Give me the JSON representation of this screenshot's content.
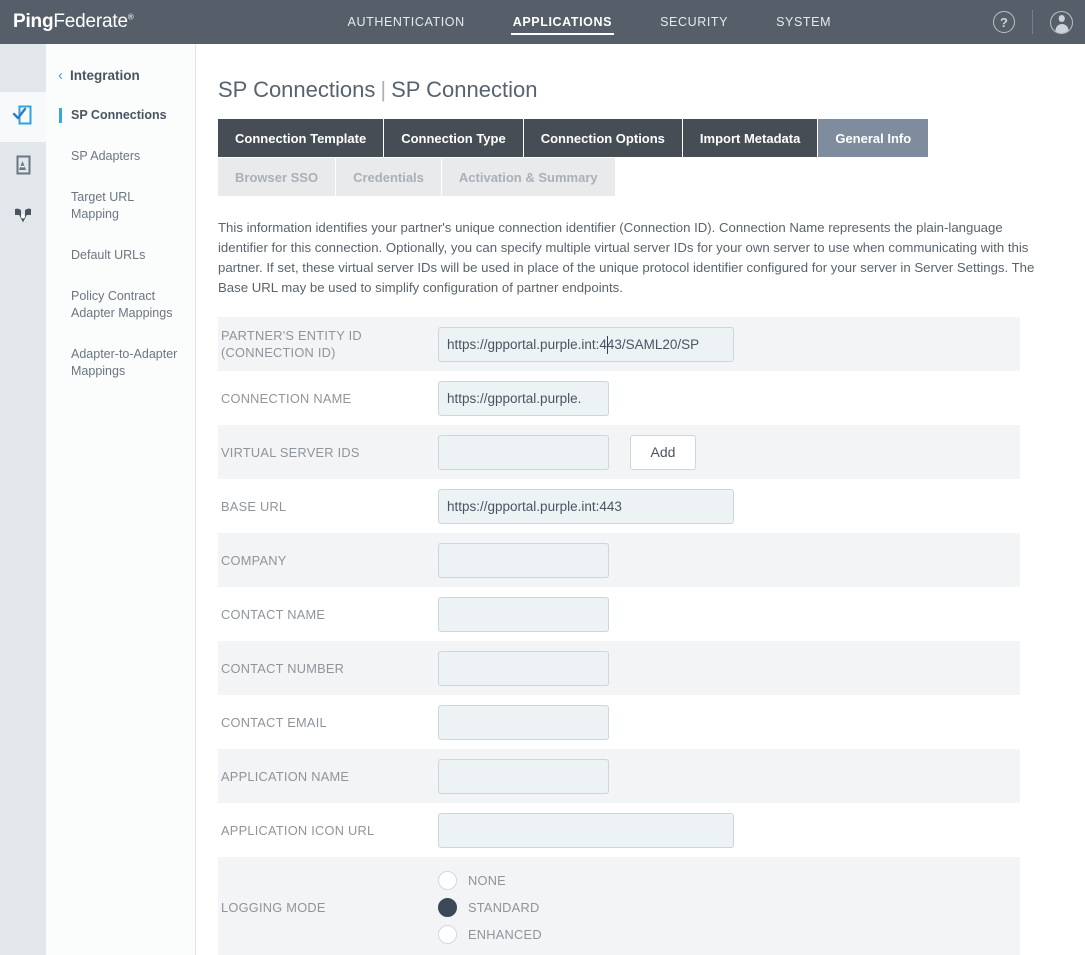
{
  "app": {
    "brand_bold": "Ping",
    "brand_light": "Federate",
    "brand_mark": "®"
  },
  "topnav": {
    "items": [
      {
        "label": "AUTHENTICATION",
        "active": false
      },
      {
        "label": "APPLICATIONS",
        "active": true
      },
      {
        "label": "SECURITY",
        "active": false
      },
      {
        "label": "SYSTEM",
        "active": false
      }
    ],
    "help_glyph": "?",
    "help_name": "help-icon",
    "user_name": "user-avatar-icon"
  },
  "rail": {
    "icons": [
      {
        "name": "sp-connections-icon",
        "active": true
      },
      {
        "name": "sp-adapters-icon",
        "active": false
      },
      {
        "name": "policy-shield-icon",
        "active": false
      }
    ],
    "accent": "#3ba5dd"
  },
  "sidebar": {
    "back_chevron": "‹",
    "back_label": "Integration",
    "items": [
      {
        "label": "SP Connections",
        "active": true
      },
      {
        "label": "SP Adapters",
        "active": false
      },
      {
        "label": "Target URL Mapping",
        "active": false
      },
      {
        "label": "Default URLs",
        "active": false
      },
      {
        "label": "Policy Contract Adapter Mappings",
        "active": false
      },
      {
        "label": "Adapter-to-Adapter Mappings",
        "active": false
      }
    ]
  },
  "page": {
    "title_parent": "SP Connections",
    "title_separator": "|",
    "title_current": "SP Connection"
  },
  "tabs": {
    "row1": [
      {
        "label": "Connection Template",
        "state": "normal"
      },
      {
        "label": "Connection Type",
        "state": "normal"
      },
      {
        "label": "Connection Options",
        "state": "normal"
      },
      {
        "label": "Import Metadata",
        "state": "normal"
      },
      {
        "label": "General Info",
        "state": "active"
      }
    ],
    "row2": [
      {
        "label": "Browser SSO",
        "state": "disabled"
      },
      {
        "label": "Credentials",
        "state": "disabled"
      },
      {
        "label": "Activation & Summary",
        "state": "disabled"
      }
    ]
  },
  "description": "This information identifies your partner's unique connection identifier (Connection ID). Connection Name represents the plain-language identifier for this connection. Optionally, you can specify multiple virtual server IDs for your own server to use when communicating with this partner. If set, these virtual server IDs will be used in place of the unique protocol identifier configured for your server in Server Settings. The Base URL may be used to simplify configuration of partner endpoints.",
  "form": {
    "entity_id": {
      "label_line1": "PARTNER'S ENTITY ID",
      "label_line2": "(CONNECTION ID)",
      "value": "https://gpportal.purple.int:443/SAML20/SP",
      "placeholder": ""
    },
    "connection_name": {
      "label": "CONNECTION NAME",
      "value": "https://gpportal.purple.",
      "placeholder": ""
    },
    "virtual_server_ids": {
      "label": "VIRTUAL SERVER IDS",
      "value": "",
      "placeholder": "",
      "add_label": "Add"
    },
    "base_url": {
      "label": "BASE URL",
      "value": "https://gpportal.purple.int:443",
      "placeholder": ""
    },
    "company": {
      "label": "COMPANY",
      "value": "",
      "placeholder": ""
    },
    "contact_name": {
      "label": "CONTACT NAME",
      "value": "",
      "placeholder": ""
    },
    "contact_number": {
      "label": "CONTACT NUMBER",
      "value": "",
      "placeholder": ""
    },
    "contact_email": {
      "label": "CONTACT EMAIL",
      "value": "",
      "placeholder": ""
    },
    "application_name": {
      "label": "APPLICATION NAME",
      "value": "",
      "placeholder": ""
    },
    "application_icon_url": {
      "label": "APPLICATION ICON URL",
      "value": "",
      "placeholder": ""
    },
    "logging_mode": {
      "label": "LOGGING MODE",
      "selected": "STANDARD",
      "options": [
        {
          "label": "NONE",
          "selected": false
        },
        {
          "label": "STANDARD",
          "selected": true
        },
        {
          "label": "ENHANCED",
          "selected": false
        }
      ]
    }
  },
  "colors": {
    "topbar": "#565f69",
    "tab_dark": "#464d55",
    "tab_active": "#7e8c9e",
    "accent_blue": "#3ba5dd",
    "row_shade": "#f2f4f5",
    "input_bg": "#edf2f4",
    "radio_selected": "#3c4858"
  }
}
